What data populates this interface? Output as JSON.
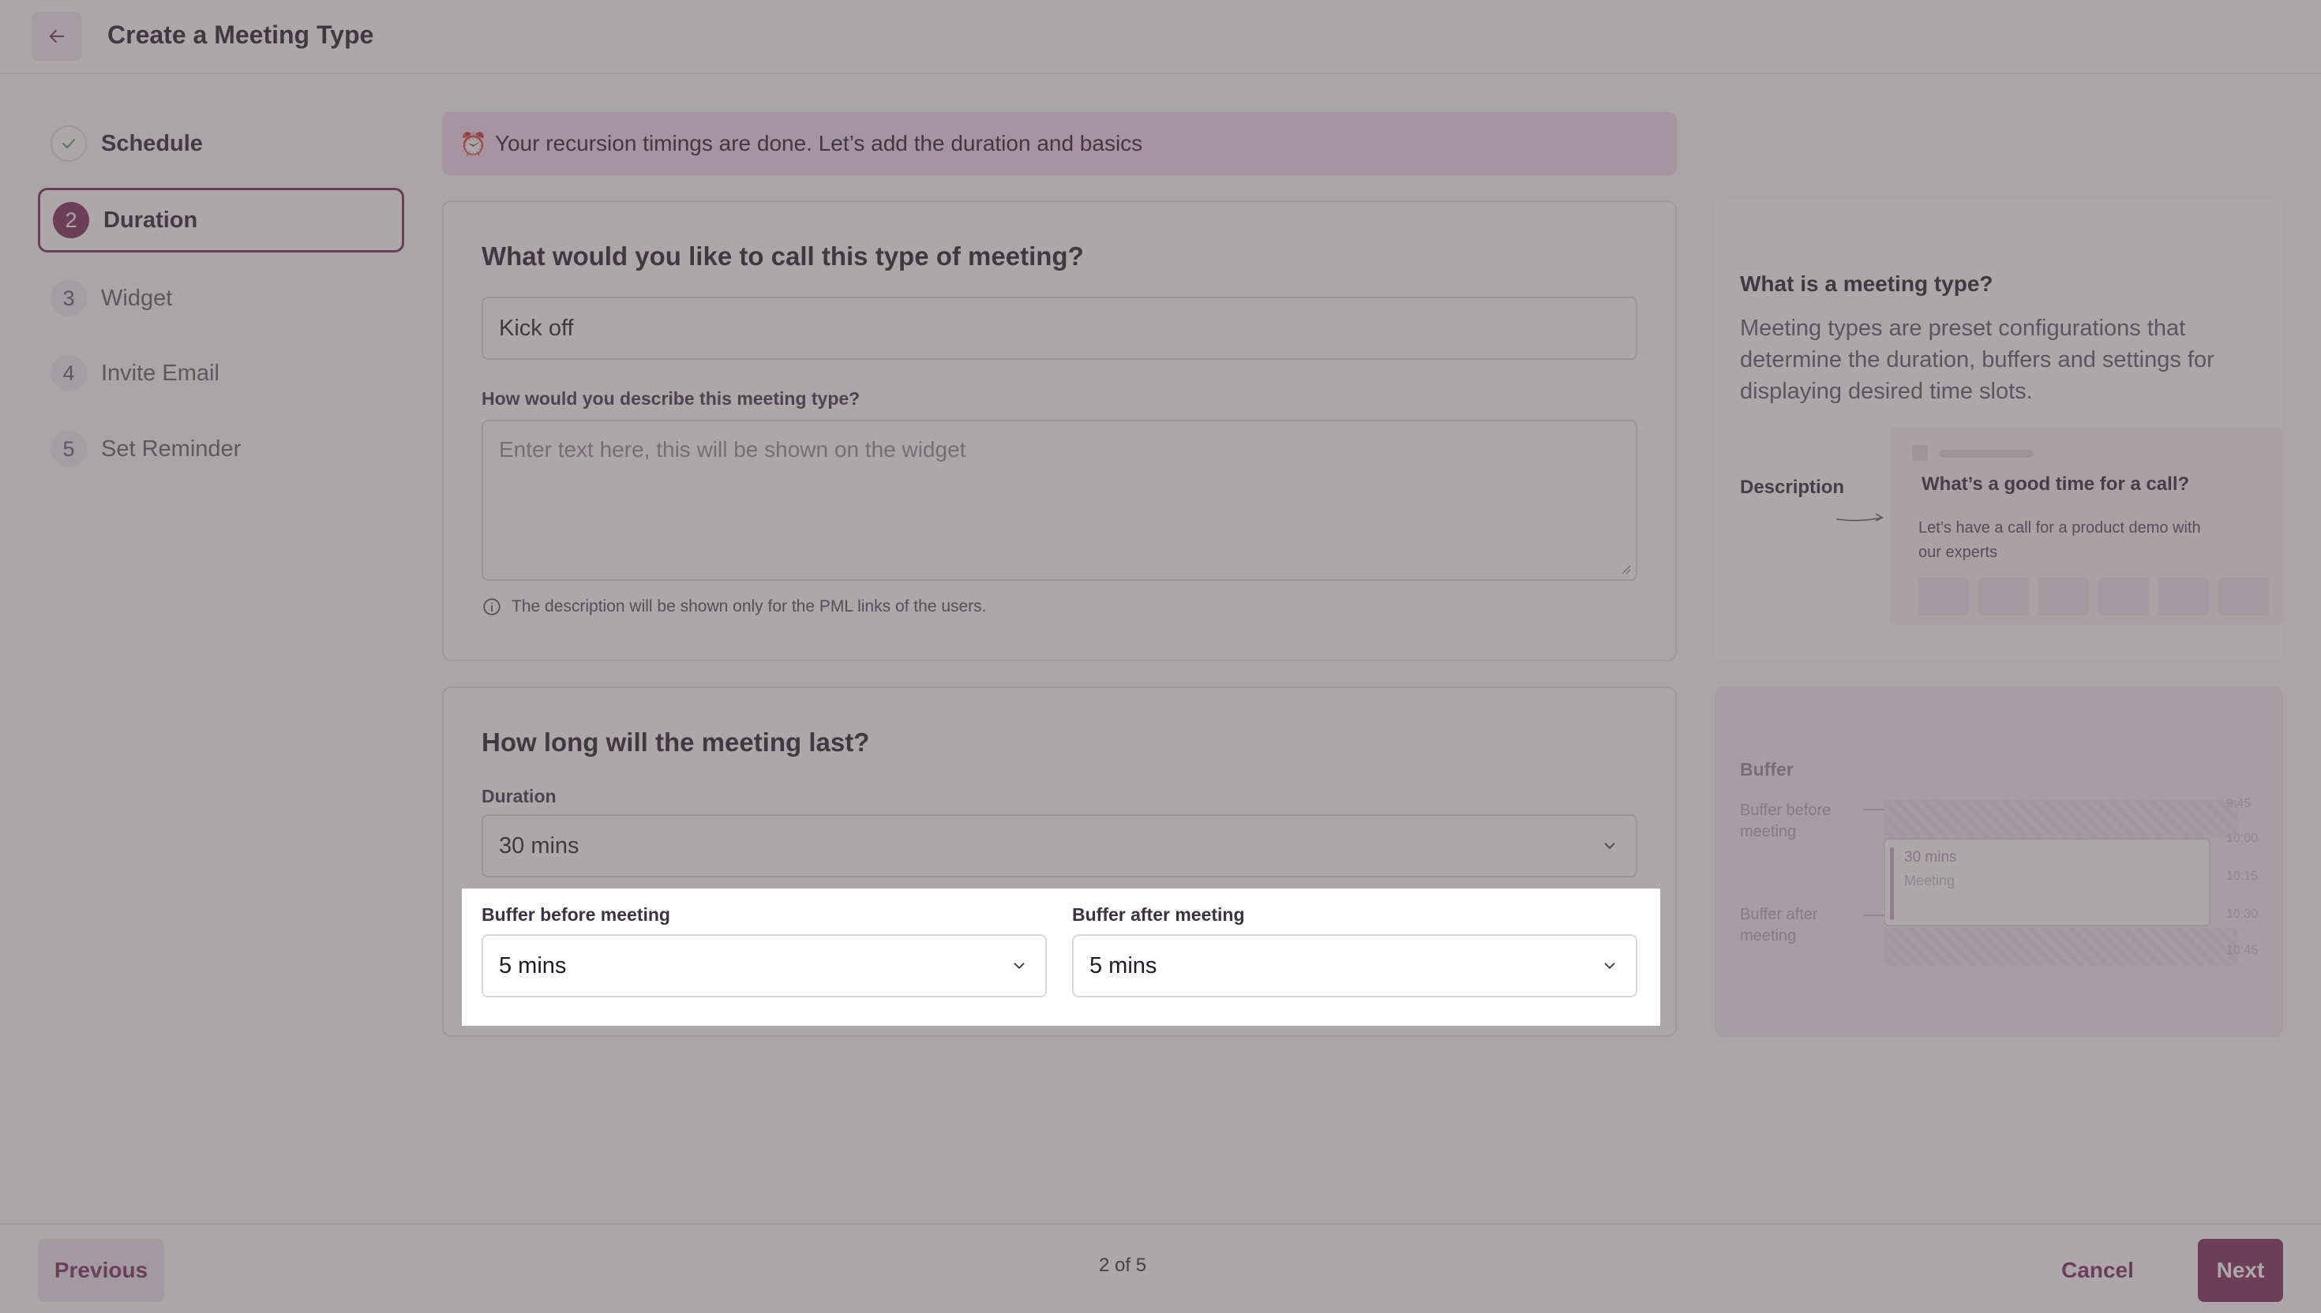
{
  "header": {
    "title": "Create a Meeting Type"
  },
  "steps": [
    {
      "num": "",
      "label": "Schedule",
      "state": "done"
    },
    {
      "num": "2",
      "label": "Duration",
      "state": "active"
    },
    {
      "num": "3",
      "label": "Widget",
      "state": "pending"
    },
    {
      "num": "4",
      "label": "Invite Email",
      "state": "pending"
    },
    {
      "num": "5",
      "label": "Set Reminder",
      "state": "pending"
    }
  ],
  "banner": {
    "icon": "⏰",
    "text": "Your recursion timings are done. Let’s add the duration and basics"
  },
  "basics": {
    "heading": "What would you like to call this type of meeting?",
    "name_value": "Kick off",
    "description_label": "How would you describe this meeting type?",
    "description_placeholder": "Enter text here, this will be shown on the widget",
    "hint": "The description will be shown only for the PML links of the users."
  },
  "duration": {
    "heading": "How long will the meeting last?",
    "duration_label": "Duration",
    "duration_value": "30 mins",
    "buffer_before_label": "Buffer before meeting",
    "buffer_before_value": "5 mins",
    "buffer_after_label": "Buffer after meeting",
    "buffer_after_value": "5 mins"
  },
  "info_meeting_type": {
    "title": "What is a meeting type?",
    "body": "Meeting types are preset configurations that determine the duration, buffers and settings for displaying desired time slots.",
    "description_label": "Description",
    "preview_title": "What’s a good time for a call?",
    "preview_text": "Let’s have a call for a product demo with our experts"
  },
  "info_buffer": {
    "title": "Buffer",
    "before_label": "Buffer before meeting",
    "after_label": "Buffer after meeting",
    "times": [
      "9:45",
      "10:00",
      "10:15",
      "10:30",
      "10:45"
    ],
    "block_duration": "30 mins",
    "block_label": "Meeting"
  },
  "footer": {
    "previous": "Previous",
    "progress": "2 of 5",
    "cancel": "Cancel",
    "next": "Next"
  },
  "colors": {
    "brand": "#7a2456",
    "banner": "#f7d6ec"
  },
  "icons": {
    "back": "arrow-left-icon",
    "done": "check-icon",
    "chevron": "chevron-down-icon",
    "hint": "info-icon"
  }
}
